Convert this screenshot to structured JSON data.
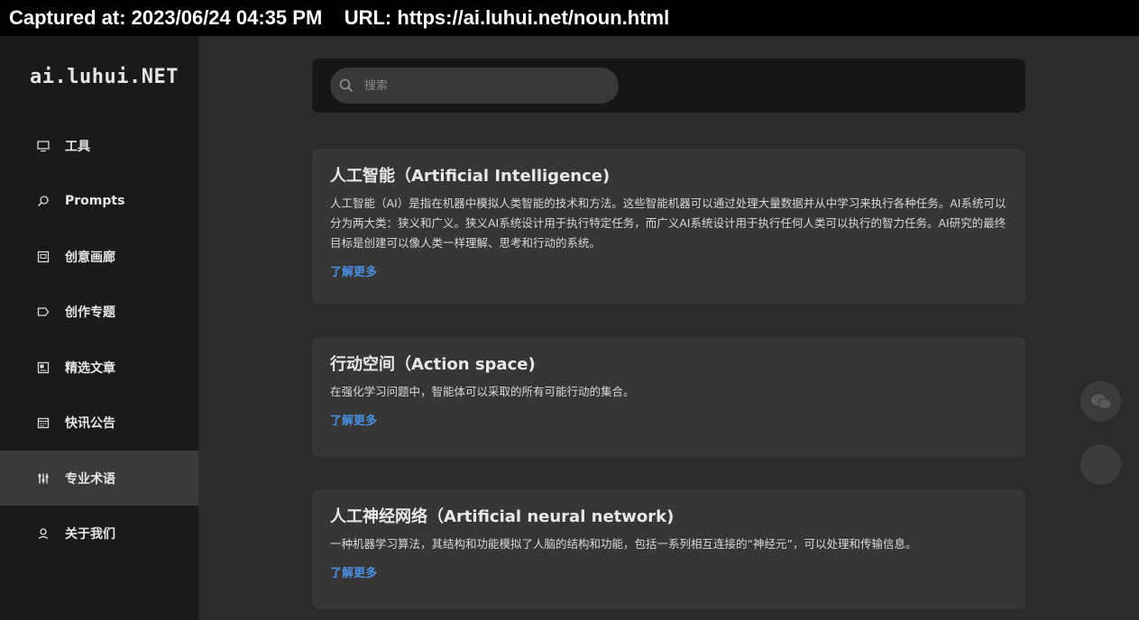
{
  "capture": {
    "text": "Captured at: 2023/06/24 04:35 PM    URL: https://ai.luhui.net/noun.html"
  },
  "logo": "ai.luhui.NET",
  "sidebar": {
    "items": [
      {
        "label": "工具",
        "icon": "monitor-icon",
        "active": false
      },
      {
        "label": "Prompts",
        "icon": "search-icon",
        "active": false
      },
      {
        "label": "创意画廊",
        "icon": "image-icon",
        "active": false
      },
      {
        "label": "创作专题",
        "icon": "tag-icon",
        "active": false
      },
      {
        "label": "精选文章",
        "icon": "news-icon",
        "active": false
      },
      {
        "label": "快讯公告",
        "icon": "calendar-icon",
        "active": false
      },
      {
        "label": "专业术语",
        "icon": "sliders-icon",
        "active": true
      },
      {
        "label": "关于我们",
        "icon": "user-icon",
        "active": false
      }
    ]
  },
  "search": {
    "placeholder": "搜索",
    "value": ""
  },
  "cards": [
    {
      "title": "人工智能（Artificial Intelligence)",
      "description": "人工智能（AI）是指在机器中模拟人类智能的技术和方法。这些智能机器可以通过处理大量数据并从中学习来执行各种任务。AI系统可以分为两大类：狭义和广义。狭义AI系统设计用于执行特定任务，而广义AI系统设计用于执行任何人类可以执行的智力任务。AI研究的最终目标是创建可以像人类一样理解、思考和行动的系统。",
      "link": "了解更多"
    },
    {
      "title": "行动空间（Action space)",
      "description": "在强化学习问题中，智能体可以采取的所有可能行动的集合。",
      "link": "了解更多"
    },
    {
      "title": "人工神经网络（Artificial neural network)",
      "description": "一种机器学习算法，其结构和功能模拟了人脑的结构和功能，包括一系列相互连接的“神经元”，可以处理和传输信息。",
      "link": "了解更多"
    }
  ],
  "floating": {
    "wechat_icon": "wechat-icon",
    "top_icon": "back-to-top-icon"
  },
  "colors": {
    "accent_link": "#4a8fe0",
    "sidebar_bg": "#1a1a1a",
    "main_bg": "#2b2b2b",
    "card_bg": "#363636"
  }
}
